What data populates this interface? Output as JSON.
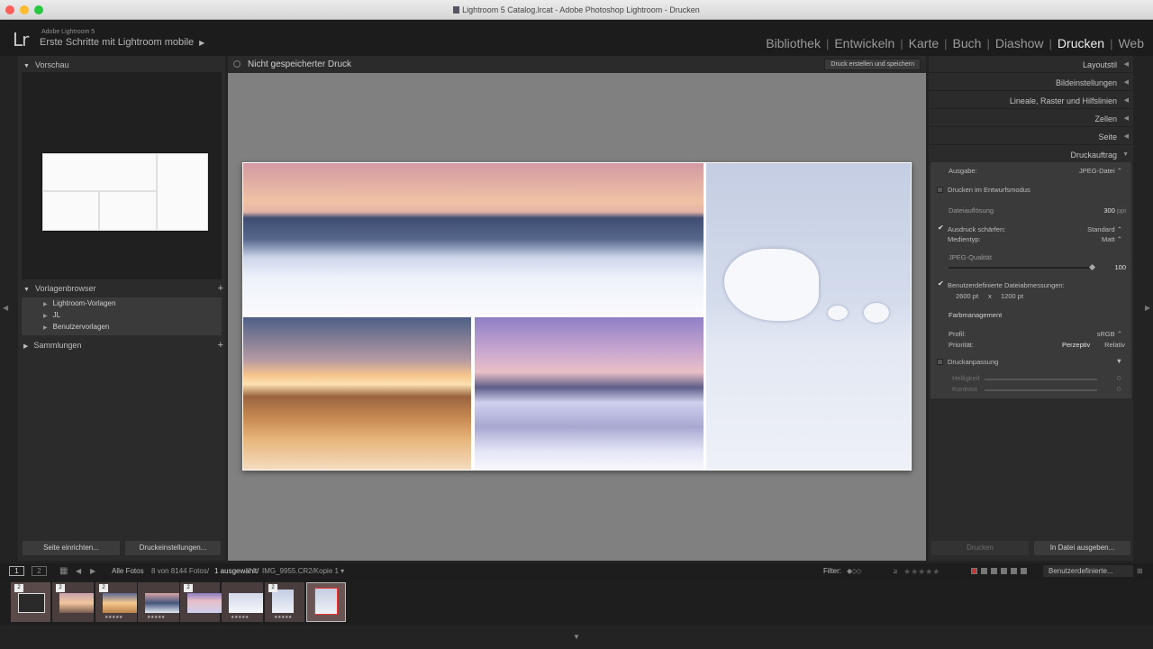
{
  "window": {
    "title": "Lightroom 5 Catalog.lrcat - Adobe Photoshop Lightroom - Drucken"
  },
  "identity": {
    "logo": "Lr",
    "product": "Adobe Lightroom 5",
    "plate": "Erste Schritte mit Lightroom mobile",
    "plate_arrow": "▶"
  },
  "modules": [
    "Bibliothek",
    "Entwickeln",
    "Karte",
    "Buch",
    "Diashow",
    "Drucken",
    "Web"
  ],
  "active_module": "Drucken",
  "left_panel": {
    "preview_header": "Vorschau",
    "templates_header": "Vorlagenbrowser",
    "templates": [
      "Lightroom-Vorlagen",
      "JL",
      "Benutzervorlagen"
    ],
    "collections_header": "Sammlungen",
    "page_setup_button": "Seite einrichten...",
    "print_settings_button": "Druckeinstellungen..."
  },
  "center": {
    "title": "Nicht gespeicherter Druck",
    "save_button": "Druck erstellen und speichern"
  },
  "right_panel": {
    "sections": [
      "Layoutstil",
      "Bildeinstellungen",
      "Lineale, Raster und Hilfslinien",
      "Zellen",
      "Seite",
      "Druckauftrag"
    ],
    "job": {
      "output_label": "Ausgabe:",
      "output_value": "JPEG-Datei",
      "draft_mode": "Drucken im Entwurfsmodus",
      "resolution_label": "Dateiauflösung",
      "resolution_value": "300",
      "resolution_unit": "ppi",
      "sharpen_label": "Ausdruck schärfen:",
      "sharpen_value": "Standard",
      "media_label": "Medientyp:",
      "media_value": "Matt",
      "quality_label": "JPEG-Qualität",
      "quality_value": "100",
      "quality_fraction": 1.0,
      "custom_dims_label": "Benutzerdefinierte Dateiabmessungen:",
      "width": "2600 pt",
      "times": "x",
      "height": "1200 pt",
      "color_mgmt": "Farbmanagement",
      "profile_label": "Profil:",
      "profile_value": "sRGB",
      "priority_label": "Priorität:",
      "priority_perceptual": "Perzeptiv",
      "priority_relative": "Relativ",
      "adjust_label": "Druckanpassung",
      "brightness_label": "Helligkeit",
      "brightness_value": "0",
      "contrast_label": "Kontrast",
      "contrast_value": "0"
    },
    "print_button": "Drucken",
    "export_button": "In Datei ausgeben..."
  },
  "filmstrip_bar": {
    "page1": "1",
    "page2": "2",
    "source": "Alle Fotos",
    "count": "8 von 8144 Fotos/",
    "selected": "1 ausgewählt/",
    "file": "IMG_9955.CR2/Kopie 1",
    "filter_label": "Filter:",
    "gte": "≥",
    "preset": "Benutzerdefinierte..."
  },
  "filmstrip": {
    "badges": [
      "2",
      "2",
      "2",
      "2",
      "2",
      "2"
    ],
    "stars": "★★★★★"
  },
  "colors": {
    "accent": "#e6e6e6",
    "panel": "#2b2b2b",
    "canvas": "#808080"
  }
}
